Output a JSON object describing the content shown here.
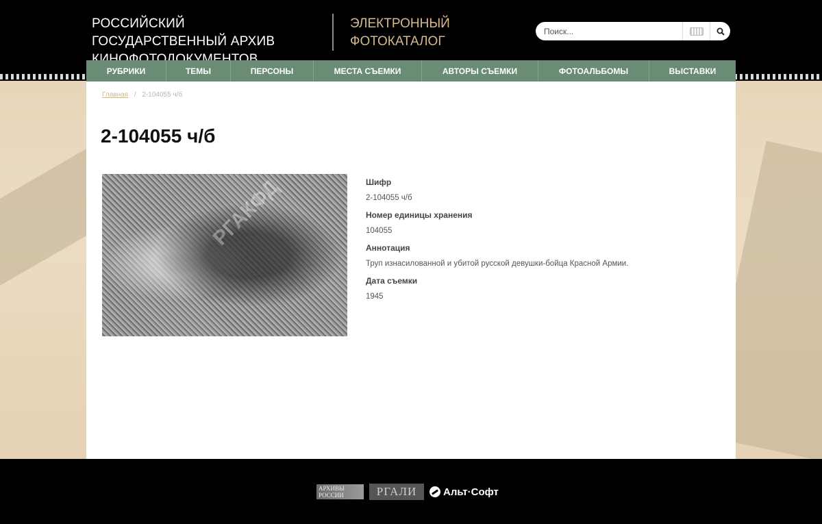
{
  "header": {
    "org_title": "РОССИЙСКИЙ ГОСУДАРСТВЕННЫЙ АРХИВ КИНОФОТОДОКУМЕНТОВ",
    "catalog_title": "ЭЛЕКТРОННЫЙ ФОТОКАТАЛОГ",
    "search": {
      "placeholder": "Поиск...",
      "value": ""
    }
  },
  "nav": {
    "items": [
      {
        "label": "РУБРИКИ"
      },
      {
        "label": "ТЕМЫ"
      },
      {
        "label": "ПЕРСОНЫ"
      },
      {
        "label": "МЕСТА СЪЕМКИ"
      },
      {
        "label": "АВТОРЫ СЪЕМКИ"
      },
      {
        "label": "ФОТОАЛЬБОМЫ"
      },
      {
        "label": "ВЫСТАВКИ"
      }
    ]
  },
  "breadcrumb": {
    "home": "Главная",
    "separator": "/",
    "current": "2-104055 ч/б"
  },
  "record": {
    "title": "2-104055 ч/б",
    "photo_watermark": "РГАКФД",
    "fields": [
      {
        "label": "Шифр",
        "value": "2-104055 ч/б"
      },
      {
        "label": "Номер единицы хранения",
        "value": "104055"
      },
      {
        "label": "Аннотация",
        "value": "Труп изнасилованной и убитой русской девушки-бойца Красной Армии."
      },
      {
        "label": "Дата съемки",
        "value": "1945"
      }
    ]
  },
  "footer": {
    "logo_archives": "АРХИВЫ РОССИИ",
    "logo_rgali": "РГАЛИ",
    "logo_altsoft": "Альт·Софт"
  },
  "colors": {
    "nav_bg": "#6a8b74",
    "catalog_title": "#d7b98c",
    "page_bg": "#e9d9c0"
  }
}
